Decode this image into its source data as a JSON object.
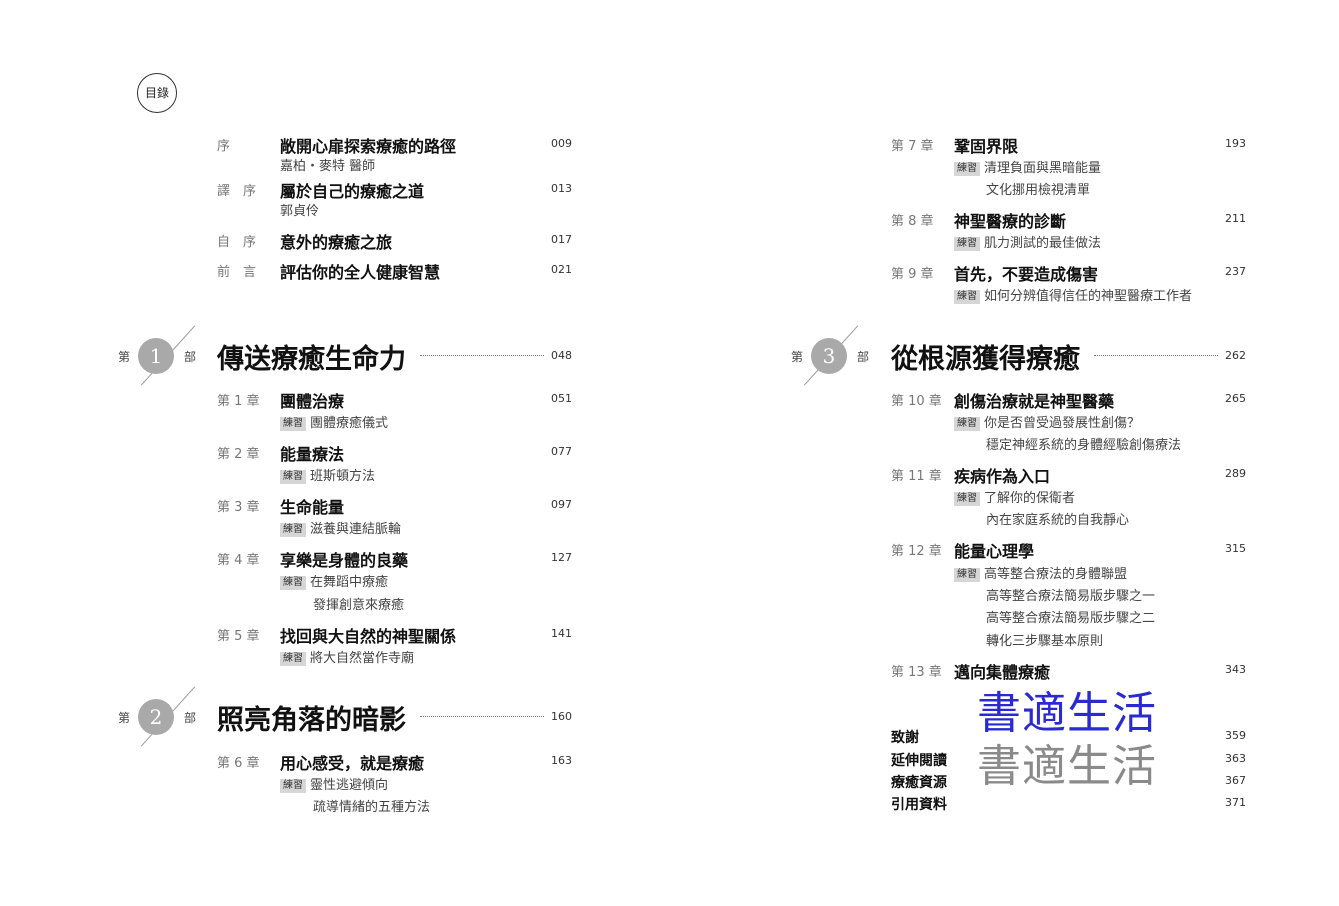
{
  "badge": "目錄",
  "front": [
    {
      "label": "序",
      "title": "敞開心扉探索療癒的路徑",
      "sub": "嘉柏・麥特 醫師",
      "page": "009"
    },
    {
      "label": "譯　序",
      "title": "屬於自己的療癒之道",
      "sub": "郭貞伶",
      "page": "013"
    },
    {
      "label": "自　序",
      "title": "意外的療癒之旅",
      "page": "017"
    },
    {
      "label": "前　言",
      "title": "評估你的全人健康智慧",
      "page": "021"
    }
  ],
  "parts": [
    {
      "pre": "第",
      "num": "1",
      "post": "部",
      "title": "傳送療癒生命力",
      "page": "048"
    },
    {
      "pre": "第",
      "num": "2",
      "post": "部",
      "title": "照亮角落的暗影",
      "page": "160"
    },
    {
      "pre": "第",
      "num": "3",
      "post": "部",
      "title": "從根源獲得療癒",
      "page": "262"
    }
  ],
  "tag": "練習",
  "chapters": [
    {
      "label": "第 1 章",
      "title": "團體治療",
      "page": "051",
      "ex": [
        "團體療癒儀式"
      ]
    },
    {
      "label": "第 2 章",
      "title": "能量療法",
      "page": "077",
      "ex": [
        "班斯頓方法"
      ]
    },
    {
      "label": "第 3 章",
      "title": "生命能量",
      "page": "097",
      "ex": [
        "滋養與連結脈輪"
      ]
    },
    {
      "label": "第 4 章",
      "title": "享樂是身體的良藥",
      "page": "127",
      "ex": [
        "在舞蹈中療癒",
        "發揮創意來療癒"
      ]
    },
    {
      "label": "第 5 章",
      "title": "找回與大自然的神聖關係",
      "page": "141",
      "ex": [
        "將大自然當作寺廟"
      ]
    },
    {
      "label": "第 6 章",
      "title": "用心感受，就是療癒",
      "page": "163",
      "ex": [
        "靈性逃避傾向",
        "疏導情緒的五種方法"
      ]
    },
    {
      "label": "第 7 章",
      "title": "鞏固界限",
      "page": "193",
      "ex": [
        "清理負面與黑暗能量",
        "文化挪用檢視清單"
      ]
    },
    {
      "label": "第 8 章",
      "title": "神聖醫療的診斷",
      "page": "211",
      "ex": [
        "肌力測試的最佳做法"
      ]
    },
    {
      "label": "第 9 章",
      "title": "首先，不要造成傷害",
      "page": "237",
      "ex": [
        "如何分辨值得信任的神聖醫療工作者"
      ]
    },
    {
      "label": "第 10 章",
      "title": "創傷治療就是神聖醫藥",
      "page": "265",
      "ex": [
        "你是否曾受過發展性創傷？",
        "穩定神經系統的身體經驗創傷療法"
      ]
    },
    {
      "label": "第 11 章",
      "title": "疾病作為入口",
      "page": "289",
      "ex": [
        "了解你的保衛者",
        "內在家庭系統的自我靜心"
      ]
    },
    {
      "label": "第 12 章",
      "title": "能量心理學",
      "page": "315",
      "ex": [
        "高等整合療法的身體聯盟",
        "高等整合療法簡易版步驟之一",
        "高等整合療法簡易版步驟之二",
        "轉化三步驟基本原則"
      ]
    },
    {
      "label": "第 13 章",
      "title": "邁向集體療癒",
      "page": "343",
      "ex": []
    }
  ],
  "back": [
    {
      "title": "致謝",
      "page": "359"
    },
    {
      "title": "延伸閱讀",
      "page": "363"
    },
    {
      "title": "療癒資源",
      "page": "367"
    },
    {
      "title": "引用資料",
      "page": "371"
    }
  ],
  "watermark": [
    "書適生活",
    "書適生活"
  ],
  "colors": {
    "watermark_blue": "#2a2ad0",
    "watermark_gray": "#8a8a8a",
    "circle": "#a9a9a9",
    "tag_bg": "#d6d6d6"
  }
}
